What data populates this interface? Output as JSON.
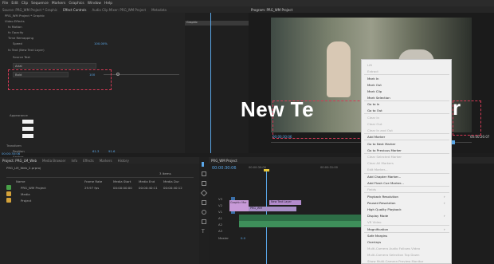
{
  "menu": [
    "File",
    "Edit",
    "Clip",
    "Sequence",
    "Markers",
    "Graphics",
    "Window",
    "Help"
  ],
  "source_tabs": {
    "source": "Source: PRG_WM Project * Graphic",
    "effect_controls": "Effect Controls",
    "audio_mixer": "Audio Clip Mixer: PRG_WM Project",
    "metadata": "Metadata"
  },
  "effect_controls": {
    "header_clip": "PRG_WM Project * Graphic",
    "timecode_label": "00:00:00:00",
    "graphic_label": "Graphic",
    "video_effects": "Video Effects",
    "motion": "fx Motion",
    "opacity": "fx Opacity",
    "time_remapping": "Time Remapping",
    "speed_label": "Speed",
    "speed_value": "100.00%",
    "text_layer": "fx Text (New Text Layer)",
    "source_text": "Source Text",
    "font": "Arial",
    "style": "Bold",
    "font_size": "100",
    "appearance": "Appearance",
    "transform": "Transform",
    "position": "Position",
    "position_x": "61.3",
    "position_y": "91.6",
    "anchor": "Anchor",
    "timecode_bottom": "00:00:30:06"
  },
  "program": {
    "tab": "Program: PRG_WM Project",
    "overlay_text": "New Te",
    "overlay_text_end": "r",
    "timecode_left": "00:00:30:06",
    "timecode_right": "00:00:26:07"
  },
  "context_menu": {
    "items": [
      {
        "label": "Lift",
        "enabled": false
      },
      {
        "label": "Extract",
        "enabled": false
      },
      {
        "label": "Mark In",
        "enabled": true
      },
      {
        "label": "Mark Out",
        "enabled": true
      },
      {
        "label": "Mark Clip",
        "enabled": true
      },
      {
        "label": "Mark Selection",
        "enabled": true
      },
      {
        "label": "Go to In",
        "enabled": true
      },
      {
        "label": "Go to Out",
        "enabled": true
      },
      {
        "label": "Clear In",
        "enabled": false
      },
      {
        "label": "Clear Out",
        "enabled": false
      },
      {
        "label": "Clear In and Out",
        "enabled": false
      },
      {
        "label": "Add Marker",
        "enabled": true
      },
      {
        "label": "Go to Next Marker",
        "enabled": true
      },
      {
        "label": "Go to Previous Marker",
        "enabled": true
      },
      {
        "label": "Clear Selected Marker",
        "enabled": false
      },
      {
        "label": "Clear All Markers",
        "enabled": false
      },
      {
        "label": "Edit Marker...",
        "enabled": false
      },
      {
        "label": "Add Chapter Marker...",
        "enabled": true
      },
      {
        "label": "Add Flash Cue Marker...",
        "enabled": true
      },
      {
        "label": "Fields",
        "enabled": false
      },
      {
        "label": "Playback Resolution",
        "enabled": true,
        "submenu": true
      },
      {
        "label": "Paused Resolution",
        "enabled": true,
        "submenu": true
      },
      {
        "label": "High Quality Playback",
        "enabled": true
      },
      {
        "label": "Display Mode",
        "enabled": true,
        "submenu": true
      },
      {
        "label": "VR Video",
        "enabled": false
      },
      {
        "label": "Magnification",
        "enabled": true,
        "submenu": true
      },
      {
        "label": "Safe Margins",
        "enabled": true
      },
      {
        "label": "Overlays",
        "enabled": true
      },
      {
        "label": "Multi-Camera Audio Follows Video",
        "enabled": false
      },
      {
        "label": "Multi-Camera Selection Top Down",
        "enabled": false
      },
      {
        "label": "Show Multi-Camera Preview Monitor",
        "enabled": false
      }
    ]
  },
  "project_panel": {
    "tabs": [
      "Project: PRG_LM_Web",
      "Media Browser",
      "Info",
      "Effects",
      "Markers",
      "History"
    ],
    "project_file": "PRG_LM_Web_2.prproj",
    "items_count": "3 Items",
    "columns": [
      "Name",
      "Frame Rate",
      "Media Start",
      "Media End",
      "Media Dur"
    ],
    "rows": [
      {
        "name": "PRG_WM Project",
        "rate": "29.97 fps",
        "start": "00:00:00:00",
        "end": "00:00:40:11",
        "dur": "00:00:40:12"
      },
      {
        "name": "Media",
        "rate": "",
        "start": "",
        "end": "",
        "dur": ""
      },
      {
        "name": "Project",
        "rate": "",
        "start": "",
        "end": "",
        "dur": ""
      }
    ]
  },
  "timeline": {
    "tab": "PRG_WM Project",
    "timecode": "00:00:30:06",
    "ruler": [
      "00:00:30:00",
      "00:00:31:00"
    ],
    "tracks": [
      "V3",
      "V2",
      "V1",
      "A1",
      "A2",
      "A3",
      "Master"
    ],
    "master_value": "0.0",
    "clip_label": "New Text Layer",
    "clip2_label": "Graphic Mor",
    "clip3_label": "PRG_WM"
  },
  "colors": {
    "accent_blue": "#5aa7e8",
    "dash_red": "#d23a55",
    "clip_pink": "#c89ad8",
    "audio_green": "#3e8f5a"
  }
}
